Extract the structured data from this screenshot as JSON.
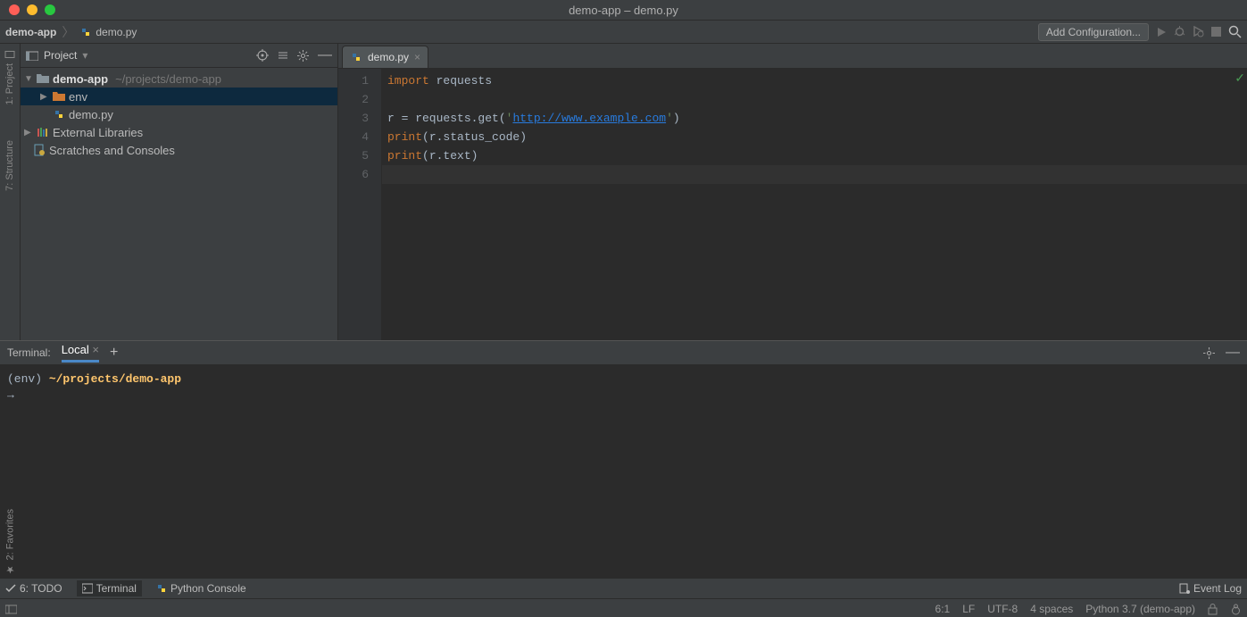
{
  "title": "demo-app – demo.py",
  "breadcrumbs": {
    "project": "demo-app",
    "file": "demo.py"
  },
  "toolbar": {
    "add_configuration": "Add Configuration..."
  },
  "left_tools": {
    "project": "1: Project",
    "structure": "7: Structure",
    "favorites": "2: Favorites"
  },
  "project_panel": {
    "title": "Project",
    "root": {
      "name": "demo-app",
      "path": "~/projects/demo-app"
    },
    "env": "env",
    "file": "demo.py",
    "external": "External Libraries",
    "scratches": "Scratches and Consoles"
  },
  "editor_tab": "demo.py",
  "code": {
    "l1_kw": "import",
    "l1_mod": " requests",
    "l3_a": "r = requests.get(",
    "l3_s1": "'",
    "l3_url": "http://www.example.com",
    "l3_s2": "'",
    "l3_b": ")",
    "l4_a": "print",
    "l4_b": "(r.status_code)",
    "l5_a": "print",
    "l5_b": "(r.text)"
  },
  "gutter": [
    "1",
    "2",
    "3",
    "4",
    "5",
    "6"
  ],
  "terminal": {
    "title": "Terminal:",
    "tab": "Local",
    "prompt_env": "(env) ",
    "prompt_path": "~/projects/demo-app",
    "cursor": "→"
  },
  "bottom": {
    "todo": "6: TODO",
    "terminal": "Terminal",
    "python_console": "Python Console",
    "event_log": "Event Log"
  },
  "status": {
    "pos": "6:1",
    "lf": "LF",
    "enc": "UTF-8",
    "indent": "4 spaces",
    "interpreter": "Python 3.7 (demo-app)"
  }
}
